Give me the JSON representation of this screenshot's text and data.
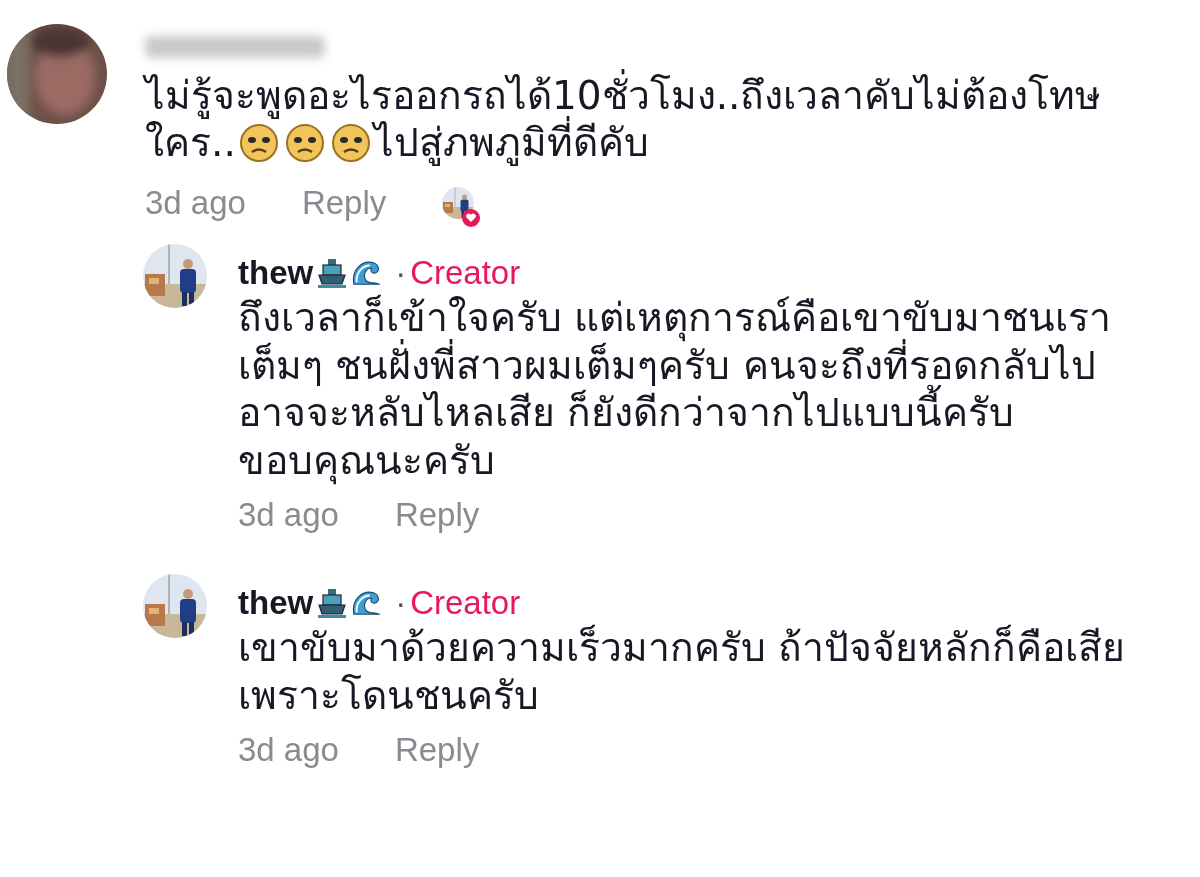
{
  "comment": {
    "body": [
      {
        "kind": "text",
        "text": "ไม่รู้จะพูดอะไรออกรถได้10ชั่วโมง..ถึงเวลาคับไม่ต้องโทษ"
      },
      {
        "kind": "text",
        "text": "ใคร.."
      },
      {
        "kind": "emoji"
      },
      {
        "kind": "emoji"
      },
      {
        "kind": "emoji"
      },
      {
        "kind": "text",
        "text": "ไปสู่ภพภูมิที่ดีคับ"
      }
    ],
    "time": "3d ago",
    "reply": "Reply",
    "liked_by_creator": true,
    "replies": [
      {
        "author": "thew",
        "name_icons": [
          {
            "kind": "ship"
          },
          {
            "kind": "wave"
          }
        ],
        "separator": "·",
        "badge": "Creator",
        "text": "ถึงเวลาก็เข้าใจครับ แต่เหตุการณ์คือเขาขับมาชนเรา เต็มๆ ชนฝั่งพี่สาวผมเต็มๆครับ คนจะถึงที่รอดกลับไป อาจจะหลับไหลเสีย ก็ยังดีกว่าจากไปแบบนี้ครับ ขอบคุณนะครับ",
        "time": "3d ago",
        "reply": "Reply"
      },
      {
        "author": "thew",
        "name_icons": [
          {
            "kind": "ship"
          },
          {
            "kind": "wave"
          }
        ],
        "separator": "·",
        "badge": "Creator",
        "text": "เขาขับมาด้วยความเร็วมากครับ ถ้าปัจจัยหลักก็คือเสีย เพราะโดนชนครับ",
        "time": "3d ago",
        "reply": "Reply"
      }
    ]
  }
}
